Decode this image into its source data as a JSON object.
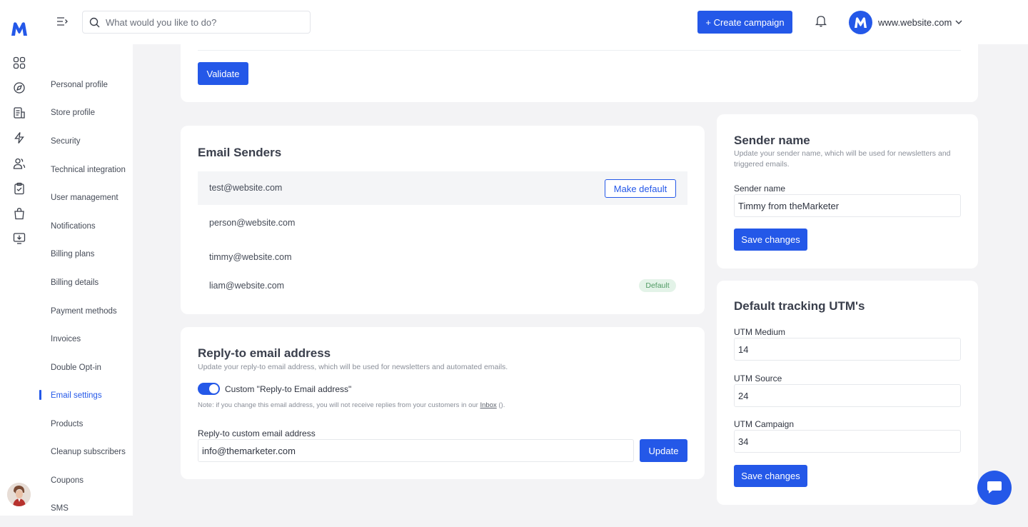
{
  "topbar": {
    "search_placeholder": "What would you like to do?",
    "create_campaign_label": "+ Create campaign",
    "site_name": "www.website.com"
  },
  "settings_nav": {
    "items": [
      {
        "label": "Personal profile"
      },
      {
        "label": "Store profile"
      },
      {
        "label": "Security"
      },
      {
        "label": "Technical integration"
      },
      {
        "label": "User management"
      },
      {
        "label": "Notifications"
      },
      {
        "label": "Billing plans"
      },
      {
        "label": "Billing details"
      },
      {
        "label": "Payment methods"
      },
      {
        "label": "Invoices"
      },
      {
        "label": "Double Opt-in"
      },
      {
        "label": "Email settings",
        "active": true
      },
      {
        "label": "Products"
      },
      {
        "label": "Cleanup subscribers"
      },
      {
        "label": "Coupons"
      },
      {
        "label": "SMS"
      }
    ]
  },
  "validate_card": {
    "validate_label": "Validate"
  },
  "email_senders": {
    "title": "Email Senders",
    "rows": [
      {
        "email": "test@website.com",
        "action": "Make default"
      },
      {
        "email": "person@website.com"
      },
      {
        "email": "timmy@website.com"
      },
      {
        "email": "liam@website.com",
        "badge": "Default"
      }
    ]
  },
  "reply_to": {
    "title": "Reply-to email address",
    "description": "Update your reply-to email address, which will be used for newsletters and automated emails.",
    "toggle_label": "Custom \"Reply-to Email address\"",
    "toggle_on": true,
    "note_prefix": "Note: if you change this email address, you will not receive replies from your customers in our ",
    "note_link": "Inbox",
    "note_suffix": " ().",
    "field_label": "Reply-to custom email address",
    "field_value": "info@themarketer.com",
    "update_label": "Update"
  },
  "sender_name": {
    "title": "Sender name",
    "description": "Update your sender name, which will be used for newsletters and triggered emails.",
    "field_label": "Sender name",
    "field_value": "Timmy from theMarketer",
    "save_label": "Save changes"
  },
  "utm": {
    "title": "Default tracking UTM's",
    "medium_label": "UTM Medium",
    "medium_value": "14",
    "source_label": "UTM Source",
    "source_value": "24",
    "campaign_label": "UTM Campaign",
    "campaign_value": "34",
    "save_label": "Save changes"
  },
  "colors": {
    "accent": "#2458e8",
    "background": "#f3f3f5",
    "badge_bg": "#e3f3e8",
    "badge_text": "#4f9a63"
  },
  "icons": {
    "rail": [
      "grid-icon",
      "compass-icon",
      "document-icon",
      "lightning-icon",
      "users-icon",
      "clipboard-icon",
      "shopping-bag-icon",
      "download-icon"
    ]
  }
}
